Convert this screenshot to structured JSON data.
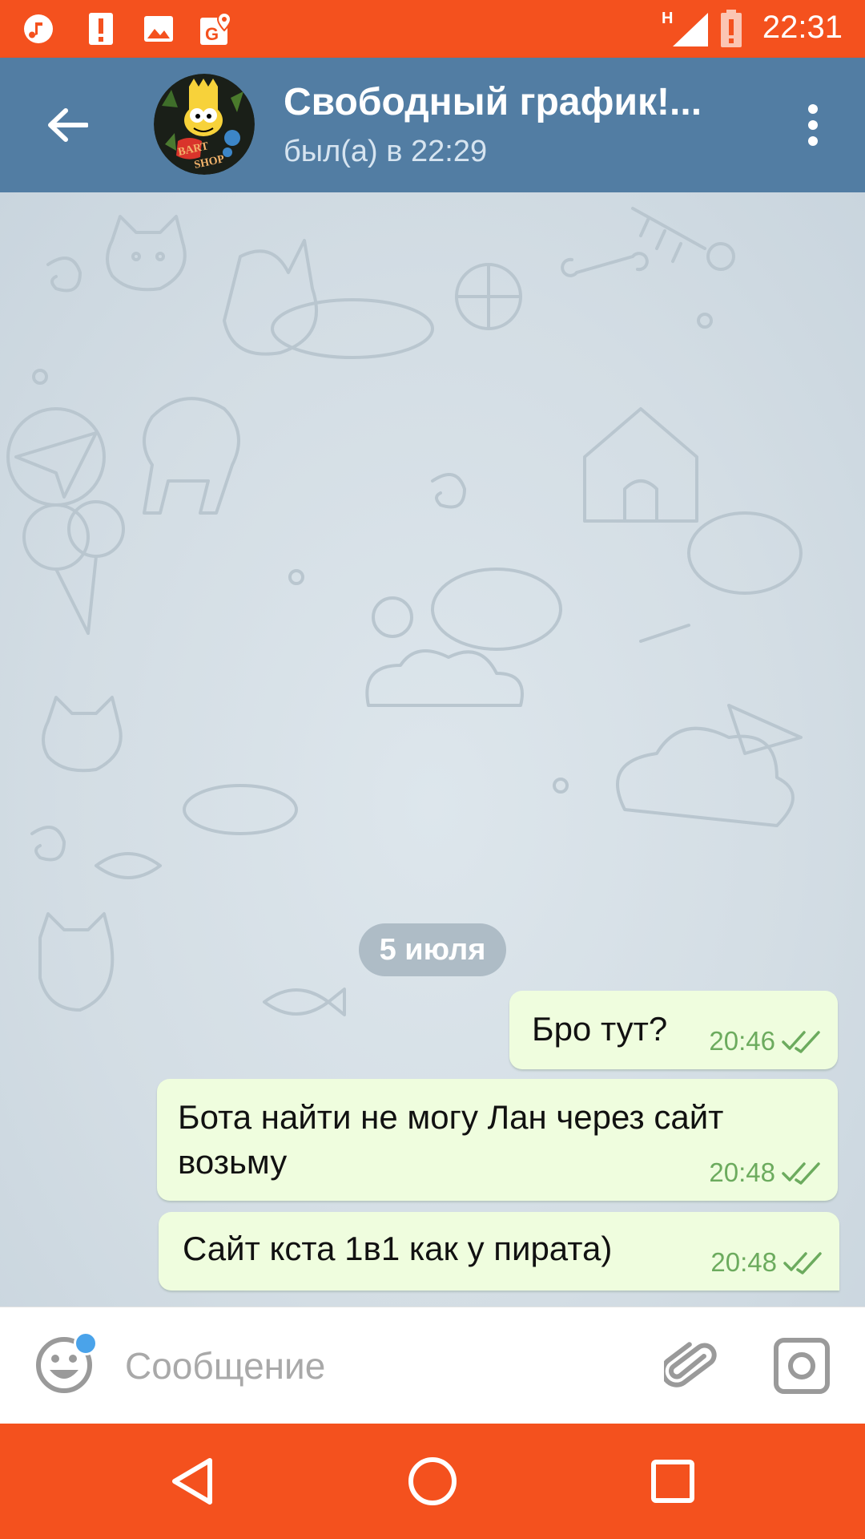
{
  "status_bar": {
    "time": "22:31",
    "network_label": "H",
    "left_icons": [
      "music-note-icon",
      "alert-icon",
      "image-icon",
      "maps-icon"
    ],
    "right_icons": [
      "signal-icon",
      "battery-alert-icon"
    ]
  },
  "header": {
    "title": "Свободный график!...",
    "status": "был(а) в 22:29",
    "avatar_lettering": "BART SHOP",
    "color": "#527da3"
  },
  "chat": {
    "date_separator": "5 июля",
    "messages": [
      {
        "text": "Бро тут?",
        "time": "20:46",
        "status": "read"
      },
      {
        "text": "Бота найти не могу Лан через сайт возьму",
        "time": "20:48",
        "status": "read"
      },
      {
        "text": "Сайт кста 1в1 как у пирата)",
        "time": "20:48",
        "status": "read"
      }
    ],
    "bubble_color": "#effdde",
    "time_color": "#6cab5e"
  },
  "input": {
    "placeholder": "Сообщение",
    "value": ""
  },
  "nav": {
    "buttons": [
      "back-icon",
      "home-icon",
      "recents-icon"
    ],
    "color": "#f4511e"
  }
}
